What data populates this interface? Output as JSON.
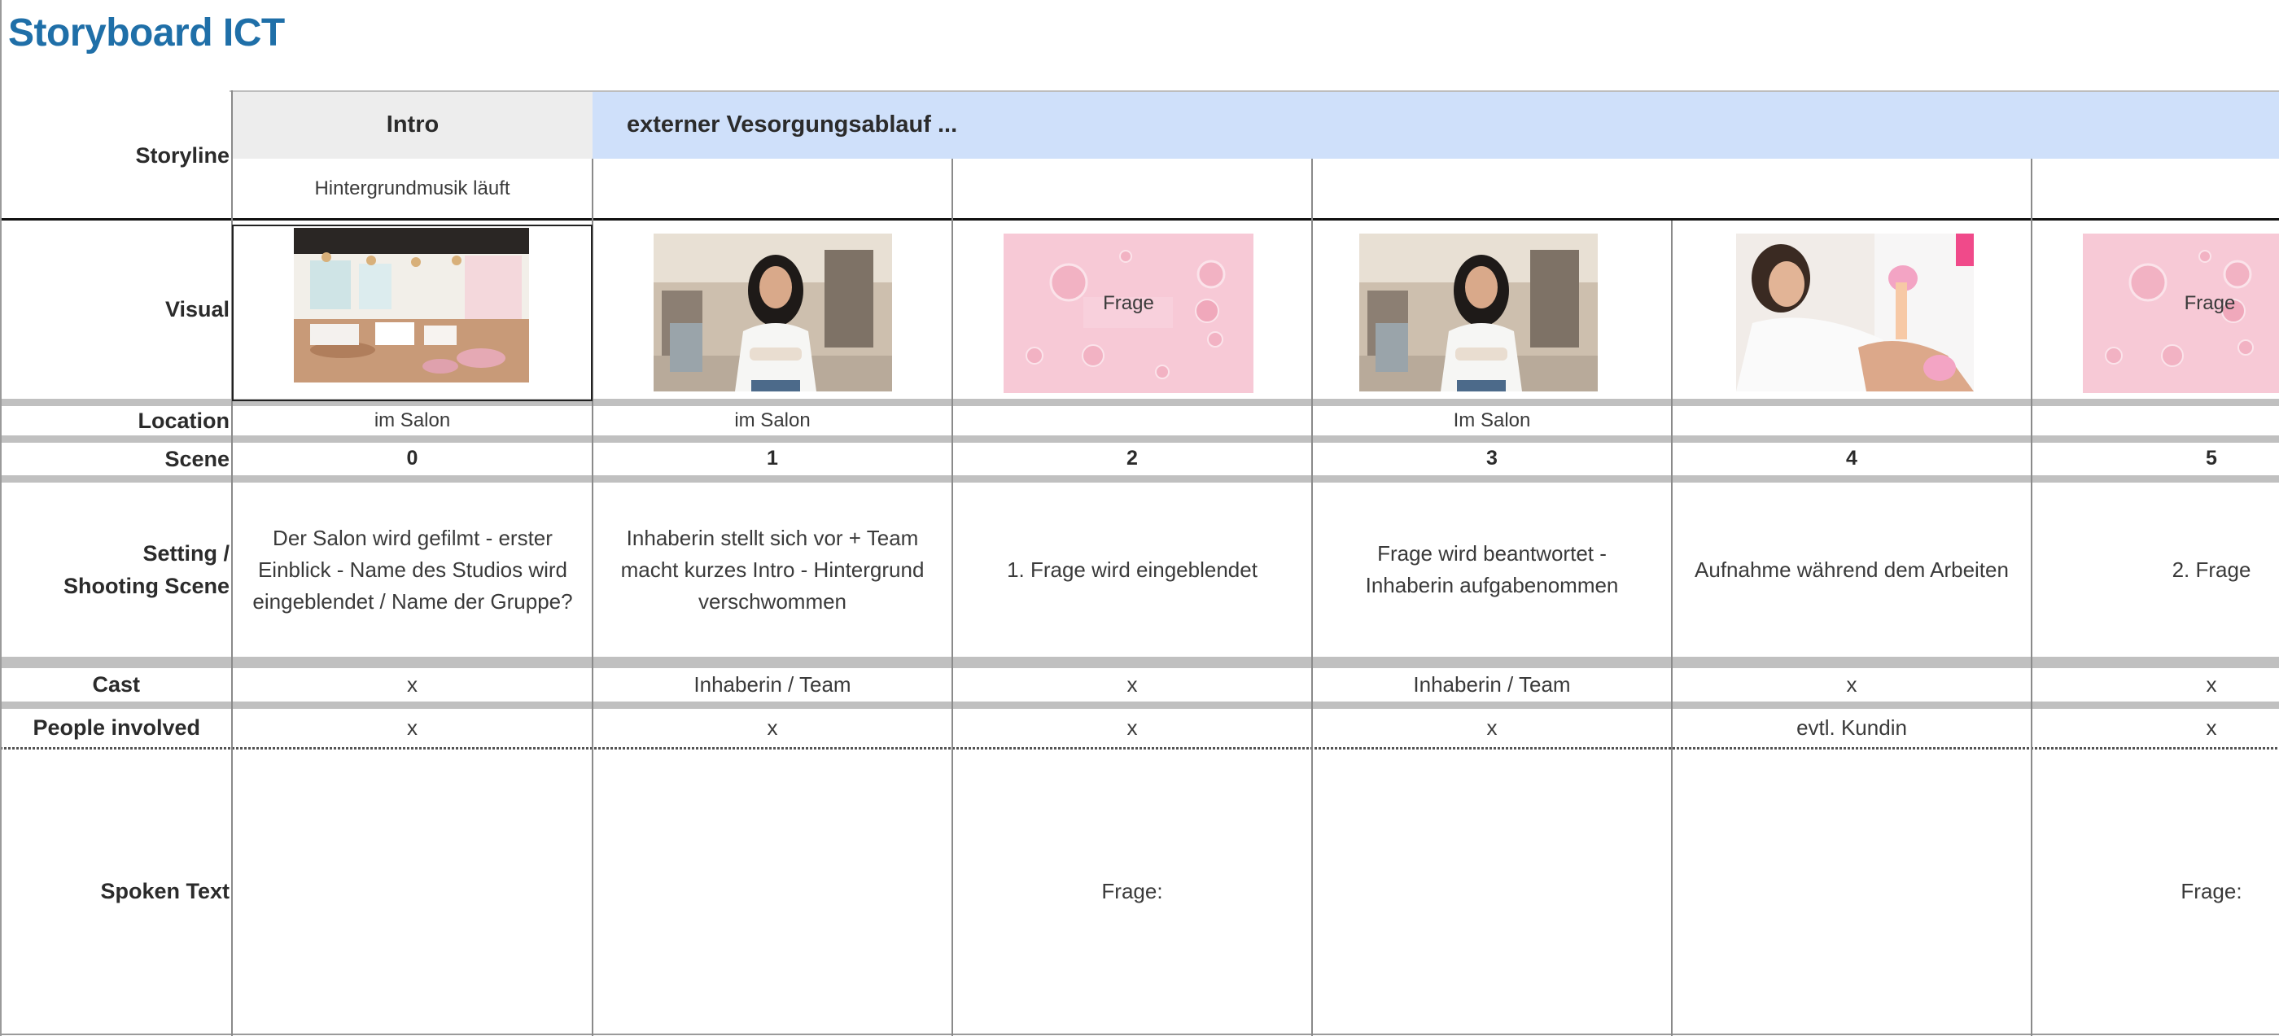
{
  "title": "Storyboard ICT",
  "row_labels": {
    "storyline": "Storyline",
    "visual": "Visual",
    "location": "Location",
    "scene": "Scene",
    "setting_line1": "Setting /",
    "setting_line2": "Shooting Scene",
    "cast": "Cast",
    "people": "People involved",
    "spoken": "Spoken Text"
  },
  "storyline": {
    "intro_header": "Intro",
    "section_header": "externer Vesorgungsablauf ...",
    "intro_note": "Hintergrundmusik läuft"
  },
  "visuals": [
    {
      "kind": "salon-interior-photo"
    },
    {
      "kind": "owner-portrait-photo"
    },
    {
      "kind": "pink-bubbles-card",
      "label": "Frage"
    },
    {
      "kind": "owner-portrait-photo"
    },
    {
      "kind": "treatment-photo"
    },
    {
      "kind": "pink-bubbles-card",
      "label": "Frage"
    }
  ],
  "locations": [
    "im Salon",
    "im Salon",
    "",
    "Im Salon",
    "",
    ""
  ],
  "scenes": [
    "0",
    "1",
    "2",
    "3",
    "4",
    "5"
  ],
  "settings": [
    "Der Salon wird gefilmt - erster Einblick - Name des Studios wird eingeblendet / Name der Gruppe?",
    "Inhaberin stellt sich vor + Team macht kurzes Intro - Hintergrund verschwommen",
    "1. Frage wird eingeblendet",
    "Frage wird beantwortet - Inhaberin aufgabenommen",
    "Aufnahme während dem Arbeiten",
    "2. Frage"
  ],
  "cast": [
    "x",
    "Inhaberin / Team",
    "x",
    "Inhaberin / Team",
    "x",
    "x"
  ],
  "people": [
    "x",
    "x",
    "x",
    "x",
    "evtl. Kundin",
    "x"
  ],
  "spoken": [
    "",
    "",
    "Frage:",
    "",
    "",
    "Frage:"
  ],
  "colors": {
    "title": "#1f6fa8",
    "intro_header_bg": "#ededed",
    "section_header_bg": "#cfe0fa",
    "band_gray": "#c0c0c0",
    "bubble_pink": "#f7c9d6"
  }
}
